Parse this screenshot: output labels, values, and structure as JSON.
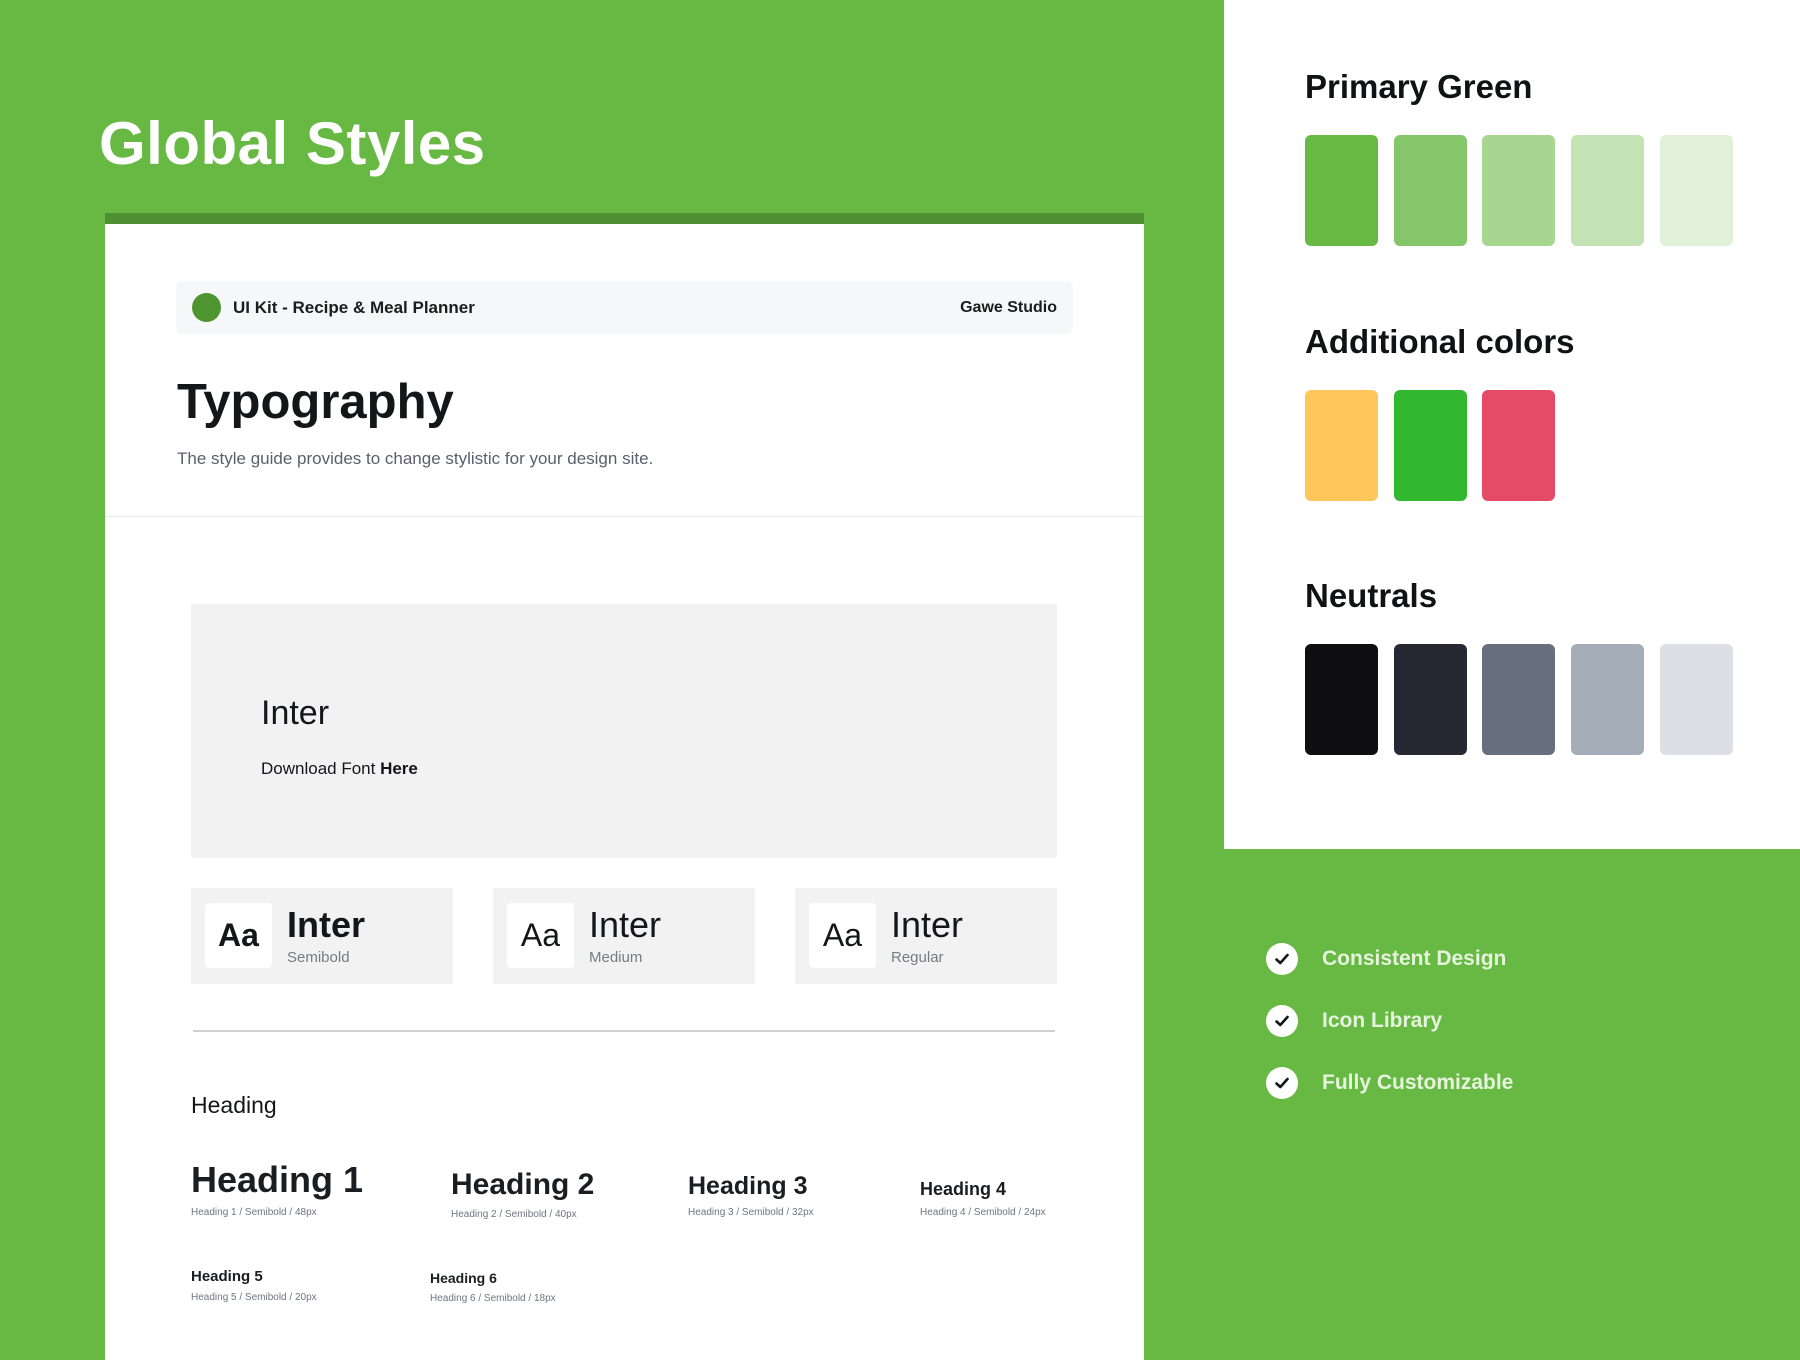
{
  "page": {
    "title": "Global Styles"
  },
  "card": {
    "kit_name": "UI Kit - Recipe & Meal Planner",
    "studio": "Gawe Studio",
    "title": "Typography",
    "description": "The style guide provides to change stylistic for your design site.",
    "font_panel": {
      "font_name": "Inter",
      "download_prefix": "Download Font ",
      "download_link": "Here"
    },
    "weights": [
      {
        "aa": "Aa",
        "name": "Inter",
        "weight": "Semibold"
      },
      {
        "aa": "Aa",
        "name": "Inter",
        "weight": "Medium"
      },
      {
        "aa": "Aa",
        "name": "Inter",
        "weight": "Regular"
      }
    ],
    "heading_section_label": "Heading",
    "headings": [
      {
        "sample": "Heading 1",
        "meta": "Heading 1 / Semibold / 48px"
      },
      {
        "sample": "Heading 2",
        "meta": "Heading 2 / Semibold / 40px"
      },
      {
        "sample": "Heading 3",
        "meta": "Heading 3 / Semibold / 32px"
      },
      {
        "sample": "Heading 4",
        "meta": "Heading 4 / Semibold / 24px"
      },
      {
        "sample": "Heading 5",
        "meta": "Heading 5 / Semibold / 20px"
      },
      {
        "sample": "Heading 6",
        "meta": "Heading 6 / Semibold / 18px"
      }
    ]
  },
  "palette": {
    "primary": {
      "title": "Primary Green",
      "colors": [
        "#68b944",
        "#86c66a",
        "#a6d68f",
        "#c3e3b4",
        "#e1f0d9"
      ]
    },
    "additional": {
      "title": "Additional colors",
      "colors": [
        "#ffc65c",
        "#31b82f",
        "#e54b66"
      ]
    },
    "neutrals": {
      "title": "Neutrals",
      "colors": [
        "#0f0f12",
        "#282833",
        "#676e7e",
        "#a4adb8",
        "#dedfe5"
      ]
    }
  },
  "features": [
    {
      "icon": "check-icon",
      "label": "Consistent Design"
    },
    {
      "icon": "check-icon",
      "label": "Icon Library"
    },
    {
      "icon": "check-icon",
      "label": "Fully Customizable"
    }
  ],
  "colors": {
    "background": "#68b944",
    "card_top_border": "#4e8f34",
    "logo_dot": "#4e9531"
  }
}
